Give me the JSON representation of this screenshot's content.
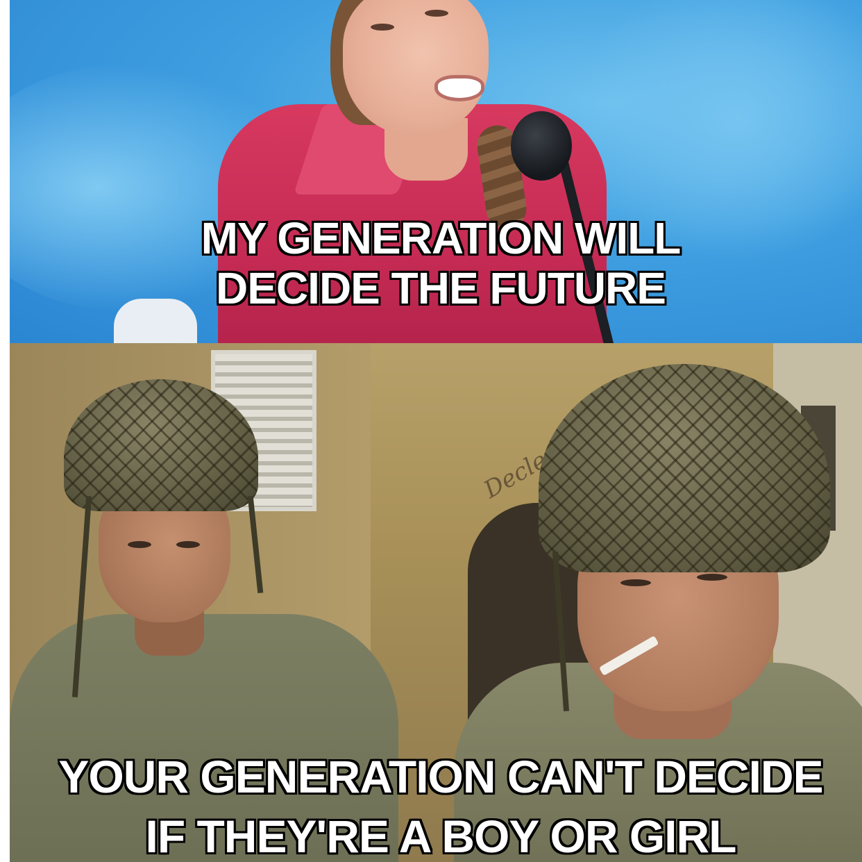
{
  "top_caption": {
    "line1": "MY GENERATION WILL",
    "line2": "DECIDE THE FUTURE"
  },
  "bottom_caption": {
    "line1": "YOUR GENERATION CAN'T DECIDE",
    "line2": "IF THEY'RE A BOY OR GIRL"
  },
  "colors": {
    "top_background": "#3e9ee0",
    "shirt": "#c42a53",
    "uniform": "#6c6e54",
    "caption_text": "#ffffff",
    "caption_outline": "#000000"
  }
}
